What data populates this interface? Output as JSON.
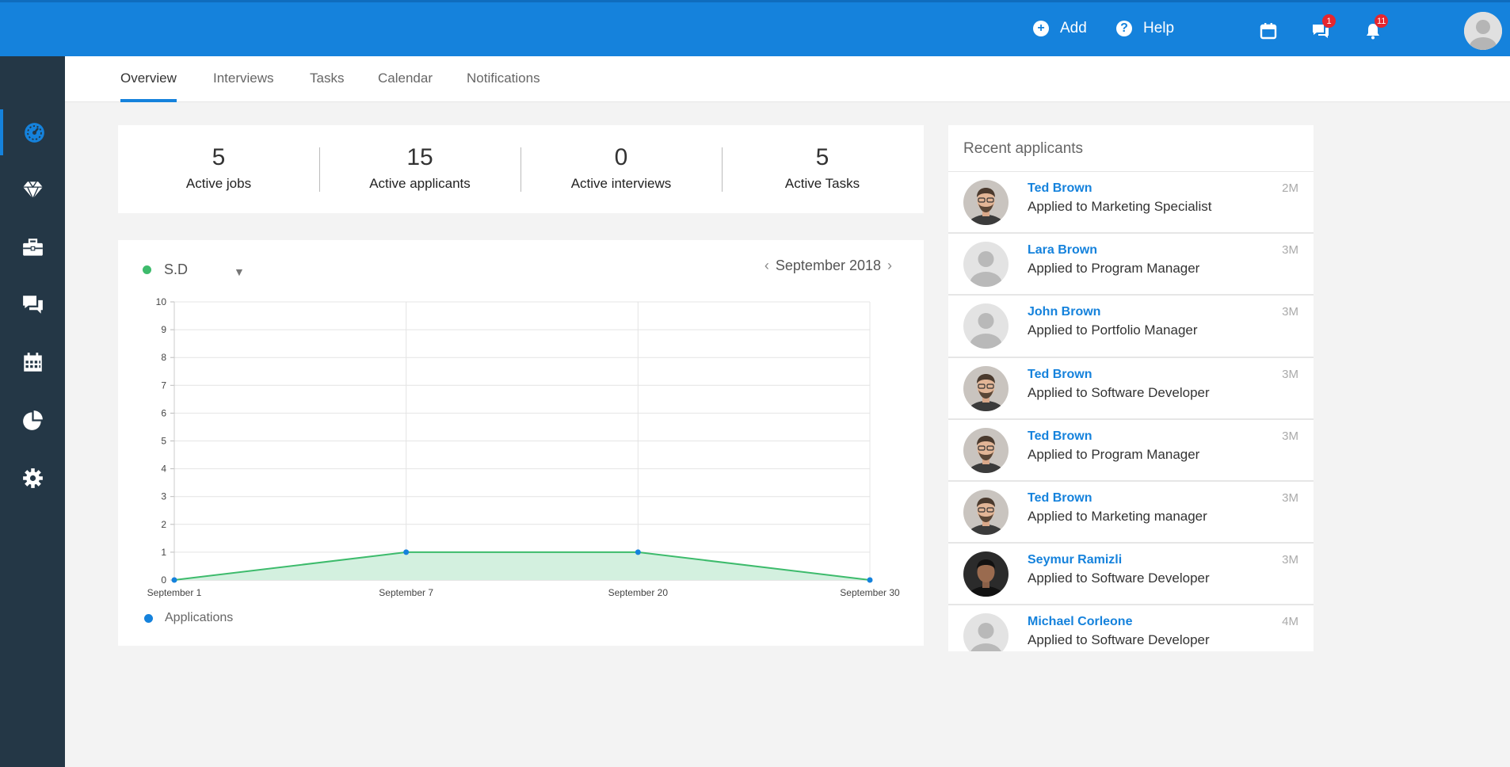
{
  "topbar": {
    "add_label": "Add",
    "help_label": "Help",
    "messages_badge": "1",
    "notifications_badge": "11",
    "icons": [
      "plus-circle-icon",
      "help-circle-icon",
      "calendar-icon",
      "chat-icon",
      "bell-icon",
      "user-avatar"
    ]
  },
  "sidebar": {
    "items": [
      {
        "icon": "dashboard-icon",
        "active": true
      },
      {
        "icon": "diamond-icon",
        "active": false
      },
      {
        "icon": "briefcase-icon",
        "active": false
      },
      {
        "icon": "chat-icon",
        "active": false
      },
      {
        "icon": "calendar-icon",
        "active": false
      },
      {
        "icon": "pie-chart-icon",
        "active": false
      },
      {
        "icon": "gear-icon",
        "active": false
      }
    ]
  },
  "tabs": [
    {
      "label": "Overview",
      "active": true
    },
    {
      "label": "Interviews",
      "active": false
    },
    {
      "label": "Tasks",
      "active": false
    },
    {
      "label": "Calendar",
      "active": false
    },
    {
      "label": "Notifications",
      "active": false
    }
  ],
  "stats": [
    {
      "value": "5",
      "label": "Active jobs"
    },
    {
      "value": "15",
      "label": "Active applicants"
    },
    {
      "value": "0",
      "label": "Active interviews"
    },
    {
      "value": "5",
      "label": "Active Tasks"
    }
  ],
  "chart_card": {
    "selector_label": "S.D",
    "month_label": "September 2018",
    "legend_label": "Applications"
  },
  "chart_data": {
    "type": "area",
    "x": [
      "September 1",
      "September 7",
      "September 20",
      "September 30"
    ],
    "series": [
      {
        "name": "Applications",
        "values": [
          0,
          1,
          1,
          0
        ]
      }
    ],
    "ylim": [
      0,
      10
    ],
    "yticks": [
      0,
      1,
      2,
      3,
      4,
      5,
      6,
      7,
      8,
      9,
      10
    ],
    "grid": true,
    "legend": "bottom-left",
    "colors": {
      "line": "#3dbb6c",
      "fill": "#d3f0df",
      "points": "#1582dc"
    }
  },
  "recent": {
    "title": "Recent applicants",
    "items": [
      {
        "name": "Ted Brown",
        "desc": "Applied to Marketing Specialist",
        "time": "2M",
        "avatar": "photo"
      },
      {
        "name": "Lara Brown",
        "desc": "Applied to Program Manager",
        "time": "3M",
        "avatar": "placeholder"
      },
      {
        "name": "John Brown",
        "desc": "Applied to Portfolio Manager",
        "time": "3M",
        "avatar": "placeholder"
      },
      {
        "name": "Ted Brown",
        "desc": "Applied to Software Developer",
        "time": "3M",
        "avatar": "photo"
      },
      {
        "name": "Ted Brown",
        "desc": "Applied to Program Manager",
        "time": "3M",
        "avatar": "photo"
      },
      {
        "name": "Ted Brown",
        "desc": "Applied to Marketing manager",
        "time": "3M",
        "avatar": "photo"
      },
      {
        "name": "Seymur Ramizli",
        "desc": "Applied to Software Developer",
        "time": "3M",
        "avatar": "photo-dark"
      },
      {
        "name": "Michael Corleone",
        "desc": "Applied to Software Developer",
        "time": "4M",
        "avatar": "placeholder"
      }
    ]
  },
  "colors": {
    "brand": "#1582dc",
    "sidebar": "#243746",
    "accent_green": "#3dbb6c",
    "badge_red": "#e5262e"
  }
}
